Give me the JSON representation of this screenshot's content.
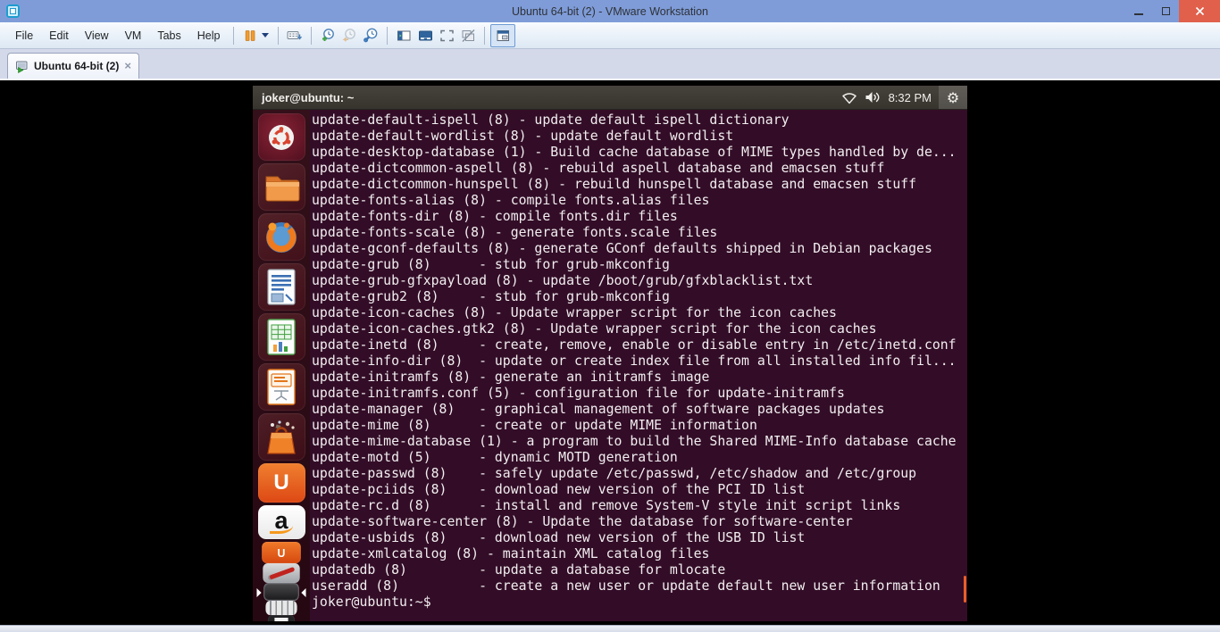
{
  "titlebar": {
    "title": "Ubuntu 64-bit (2) - VMware Workstation"
  },
  "menubar": {
    "items": [
      "File",
      "Edit",
      "View",
      "VM",
      "Tabs",
      "Help"
    ]
  },
  "toolbar": {
    "buttons": [
      "suspend",
      "send-ctrl-alt-del",
      "take-snapshot",
      "revert-snapshot",
      "manage-snapshots",
      "show-library",
      "show-thumbnail-bar",
      "fullscreen",
      "unity-mode",
      "console-view"
    ]
  },
  "tab": {
    "label": "Ubuntu 64-bit (2)"
  },
  "vm_panel": {
    "title": "joker@ubuntu: ~",
    "time": "8:32 PM",
    "indicators": [
      "network",
      "volume",
      "clock",
      "session-gear"
    ]
  },
  "launcher": {
    "items": [
      "dash-home",
      "files",
      "firefox",
      "libreoffice-writer",
      "libreoffice-calc",
      "libreoffice-impress",
      "ubuntu-software-center",
      "ubuntu-one",
      "amazon",
      "ubuntu-one-music",
      "system-settings",
      "terminal",
      "workspace-keys",
      "backup-floppy",
      "stack-base"
    ],
    "ubuntu_one_glyph": "U",
    "music_glyph": "U",
    "amazon_glyph": "a"
  },
  "terminal": {
    "lines": [
      "update-default-ispell (8) - update default ispell dictionary",
      "update-default-wordlist (8) - update default wordlist",
      "update-desktop-database (1) - Build cache database of MIME types handled by de...",
      "update-dictcommon-aspell (8) - rebuild aspell database and emacsen stuff",
      "update-dictcommon-hunspell (8) - rebuild hunspell database and emacsen stuff",
      "update-fonts-alias (8) - compile fonts.alias files",
      "update-fonts-dir (8) - compile fonts.dir files",
      "update-fonts-scale (8) - generate fonts.scale files",
      "update-gconf-defaults (8) - generate GConf defaults shipped in Debian packages",
      "update-grub (8)      - stub for grub-mkconfig",
      "update-grub-gfxpayload (8) - update /boot/grub/gfxblacklist.txt",
      "update-grub2 (8)     - stub for grub-mkconfig",
      "update-icon-caches (8) - Update wrapper script for the icon caches",
      "update-icon-caches.gtk2 (8) - Update wrapper script for the icon caches",
      "update-inetd (8)     - create, remove, enable or disable entry in /etc/inetd.conf",
      "update-info-dir (8)  - update or create index file from all installed info fil...",
      "update-initramfs (8) - generate an initramfs image",
      "update-initramfs.conf (5) - configuration file for update-initramfs",
      "update-manager (8)   - graphical management of software packages updates",
      "update-mime (8)      - create or update MIME information",
      "update-mime-database (1) - a program to build the Shared MIME-Info database cache",
      "update-motd (5)      - dynamic MOTD generation",
      "update-passwd (8)    - safely update /etc/passwd, /etc/shadow and /etc/group",
      "update-pciids (8)    - download new version of the PCI ID list",
      "update-rc.d (8)      - install and remove System-V style init script links",
      "update-software-center (8) - Update the database for software-center",
      "update-usbids (8)    - download new version of the USB ID list",
      "update-xmlcatalog (8) - maintain XML catalog files",
      "updatedb (8)         - update a database for mlocate",
      "useradd (8)          - create a new user or update default new user information",
      "joker@ubuntu:~$ "
    ]
  },
  "colors": {
    "titlebar": "#7f9cd8",
    "close_button": "#e0604c",
    "toolbar_blue": "#30649c",
    "suspend_orange": "#f29b30",
    "terminal_bg": "#330d27",
    "terminal_fg": "#f2eef0",
    "panel_bg": "#3c3934",
    "scrollbar_orange": "#e95f29",
    "launcher_bg": "#2c0a14"
  }
}
